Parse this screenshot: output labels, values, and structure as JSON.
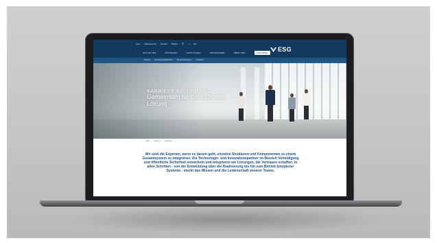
{
  "site": {
    "logo_text": "ESG",
    "colors": {
      "header": "#12395e",
      "subnav": "#1f5684",
      "accent": "#1d4c7c"
    },
    "utility_nav": [
      "Jobs",
      "Medienportal",
      "Kontakt",
      "DE/EN",
      "Q",
      "x",
      "EN"
    ],
    "main_nav": [
      {
        "label": "AKTUELLES",
        "active": false
      },
      {
        "label": "LÖSUNGEN",
        "active": false
      },
      {
        "label": "LEISTUNGEN",
        "active": false
      },
      {
        "label": "PROGRAMME",
        "active": false
      },
      {
        "label": "ÜBER UNS",
        "active": false
      },
      {
        "label": "KARRIERE",
        "active": true
      }
    ],
    "sub_nav": [
      "Karriere",
      "Einstiegsmöglichkeiten",
      "Wir als Arbeitgeber",
      "Jobsuche"
    ],
    "hero": {
      "title": "KARRIERE BEI DER ESG",
      "subtitle": "Gemeinsam für die sicherste Lösung"
    },
    "breadcrumb": [
      "ESG",
      "Karriere",
      "Überblick"
    ],
    "intro_text": "Wir sind die Experten, wenn es darum geht, einzelne Strukturen und Komponenten zu einem Gesamtsystem zu integrieren. Als Technologie- und Innovationspartner im Bereich Verteidigung und öffentliche Sicherheit entwickeln und integrieren wir Lösungen, die Vertrauen schaffen. In allen Schritten - von der Entwicklung über die Realisierung bis hin zum Betrieb komplexer Systeme - steckt das Wissen und die Leidenschaft unserer Teams."
  }
}
